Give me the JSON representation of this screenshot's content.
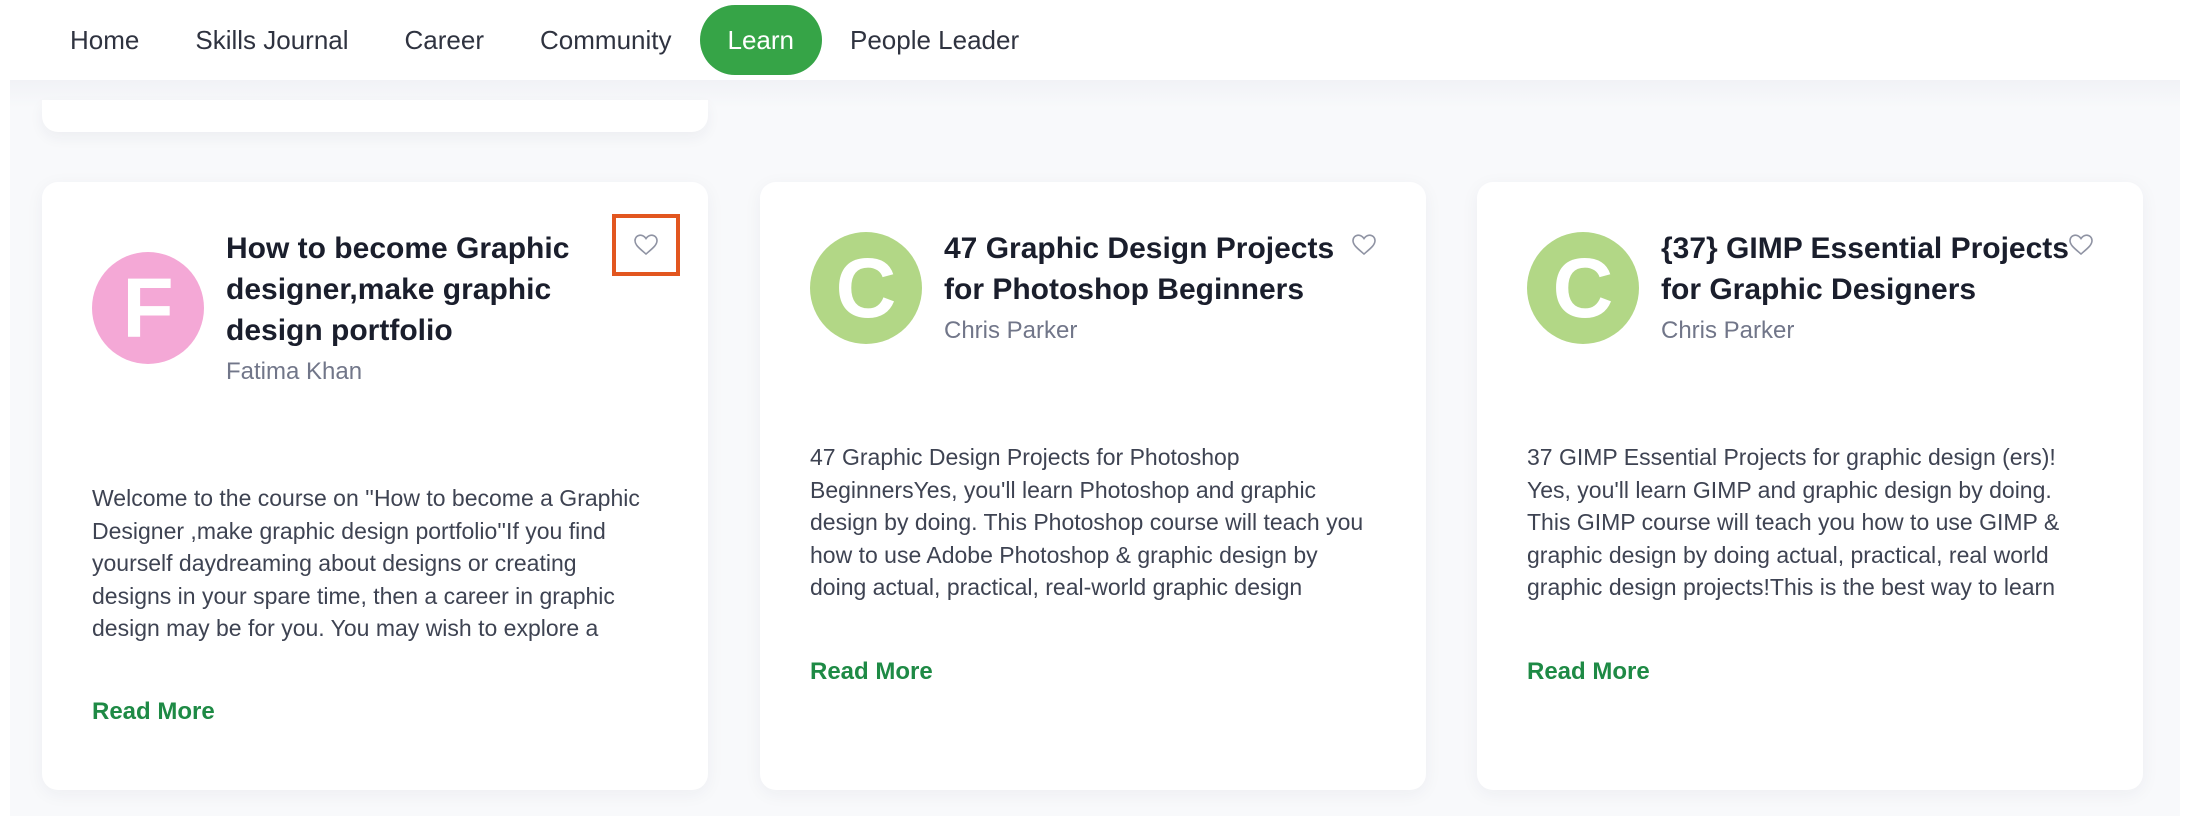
{
  "nav": {
    "items": [
      {
        "label": "Home"
      },
      {
        "label": "Skills Journal"
      },
      {
        "label": "Career"
      },
      {
        "label": "Community"
      },
      {
        "label": "Learn",
        "active": true
      },
      {
        "label": "People Leader"
      }
    ]
  },
  "colors": {
    "accent_green": "#36a447",
    "read_more_green": "#1e8a45",
    "avatar_pink": "#f4a8d6",
    "avatar_green": "#b2d786",
    "highlight_orange": "#e2561f"
  },
  "courses": [
    {
      "avatar_letter": "F",
      "title": "How to become Graphic designer,make graphic design portfolio",
      "author": "Fatima Khan",
      "description": "Welcome to the course on ''How to become a Graphic Designer ,make graphic design portfolio''If you find yourself daydreaming about designs or creating designs in your spare time, then a career in graphic design may be for you. You may wish to explore a career if you enjoy being creative.",
      "read_more": "Read More",
      "favorite_icon": "heart-outline-icon"
    },
    {
      "avatar_letter": "C",
      "title": "47 Graphic Design Projects for Photoshop Beginners",
      "author": "Chris Parker",
      "description": "47 Graphic Design Projects for Photoshop BeginnersYes, you'll learn Photoshop and graphic design by doing.  This Photoshop course will teach you how to use Adobe Photoshop & graphic design by doing actual, practical, real-world graphic design projects. This is the best way to learn.",
      "read_more": "Read More",
      "favorite_icon": "heart-outline-icon"
    },
    {
      "avatar_letter": "C",
      "title": "{37} GIMP Essential Projects for Graphic Designers",
      "author": "Chris Parker",
      "description": "37 GIMP Essential Projects for graphic design (ers)! Yes, you'll learn GIMP and graphic design by doing.  This GIMP course will teach you how to use GIMP & graphic design by doing actual, practical, real world graphic design projects!This is the best way to learn graphic design and GIMP, and it works.",
      "read_more": "Read More",
      "favorite_icon": "heart-outline-icon"
    }
  ]
}
